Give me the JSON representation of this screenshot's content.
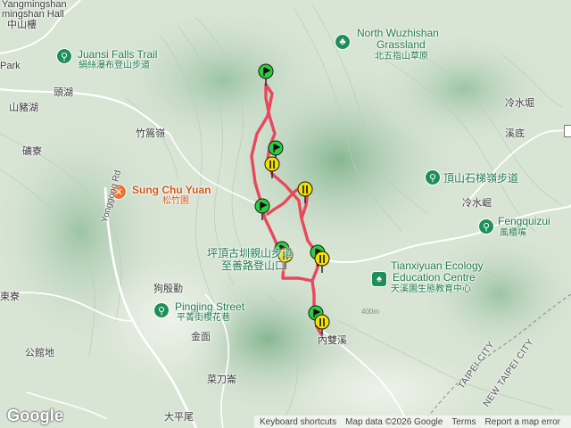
{
  "map": {
    "colors": {
      "route": "#e8485c",
      "marker_green": "#2ecc40",
      "marker_yellow": "#f2e100",
      "poi_green": "#1e8f5a",
      "poi_orange": "#e8742f"
    },
    "route_endpoints": {
      "start_marker": "green-flag",
      "end_marker": "yellow-flag"
    }
  },
  "labels": {
    "top_left_en_1": "mingshan Hall",
    "top_left_en_0": "Yangmingshan",
    "top_left_zh": "中山樓",
    "park": "Park",
    "juansi_en": "Juansi Falls Trail",
    "juansi_zh": "絹絲瀑布登山步道",
    "wuzhishan_en_1": "North Wuzhishan",
    "wuzhishan_en_2": "Grassland",
    "wuzhishan_zh": "北五指山草原",
    "toudu": "頭湖",
    "shanzhuhu": "山豬湖",
    "zhugaoling": "竹篙嶺",
    "lengshuikeng": "冷水堀",
    "xidi": "溪底",
    "jiliao": "礦寮",
    "dingshan_zh": "頂山石梯嶺步道",
    "songzhuyuan_en": "Sung Chu Yuan",
    "songzhuyuan_zh": "松竹園",
    "lengshuikeng2": "冷水崛",
    "fengqiuzui_en": "Fengquizui",
    "fengqiuzui_zh": "風櫃嘴",
    "yongsong_rd": "Yonggong Rd",
    "trailhead_zh_1": "坪頂古圳親山步道",
    "trailhead_zh_2": "至善路登山口",
    "tianxiyuan_en_1": "Tianxiyuan Ecology",
    "tianxiyuan_en_2": "Education Centre",
    "tianxiyuan_zh": "天溪園生態教育中心",
    "gouzhiqin": "狗殷勤",
    "pingjing_en": "Pingjing Street",
    "pingjing_zh": "平菁街櫻花巷",
    "dongliao": "東寮",
    "jinmian": "金面",
    "shuangxi": "內雙溪",
    "gongguandi": "公館地",
    "caidaojue": "菜刀崙",
    "dapingwei": "大平尾",
    "taipei_city": "TAIPEI CITY",
    "new_taipei_city": "NEW TAIPEI CITY",
    "contour_400": "400m"
  },
  "footer": {
    "brand": "Google",
    "keyboard": "Keyboard shortcuts",
    "map_data": "Map data ©2026 Google",
    "terms": "Terms",
    "report": "Report a map error"
  }
}
